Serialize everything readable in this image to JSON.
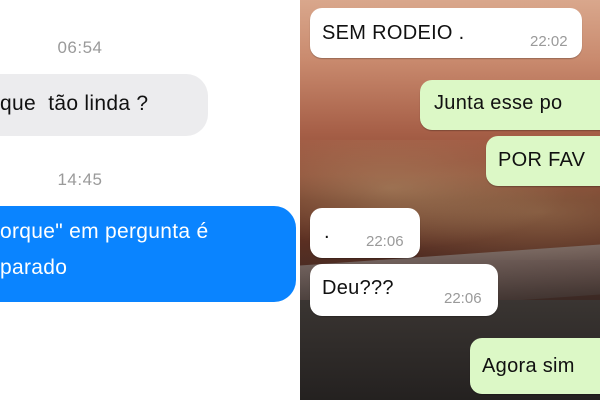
{
  "left_panel": {
    "timestamp_1": "06:54",
    "incoming_message": "que  tão linda ?",
    "timestamp_2": "14:45",
    "outgoing_message_line1": "orque\" em pergunta é",
    "outgoing_message_line2": "parado",
    "colors": {
      "incoming_bubble": "#ececee",
      "outgoing_bubble": "#0a84ff"
    }
  },
  "right_panel": {
    "messages": [
      {
        "text": "SEM RODEIO .",
        "time": "22:02",
        "direction": "received"
      },
      {
        "text": "Junta esse po",
        "time": "",
        "direction": "sent"
      },
      {
        "text": "POR FAV",
        "time": "",
        "direction": "sent"
      },
      {
        "text": ".",
        "time": "22:06",
        "direction": "received"
      },
      {
        "text": "Deu???",
        "time": "22:06",
        "direction": "received"
      },
      {
        "text": "Agora sim",
        "time": "",
        "direction": "sent"
      }
    ],
    "colors": {
      "received_bubble": "#ffffff",
      "sent_bubble": "#dcf8c6"
    }
  }
}
